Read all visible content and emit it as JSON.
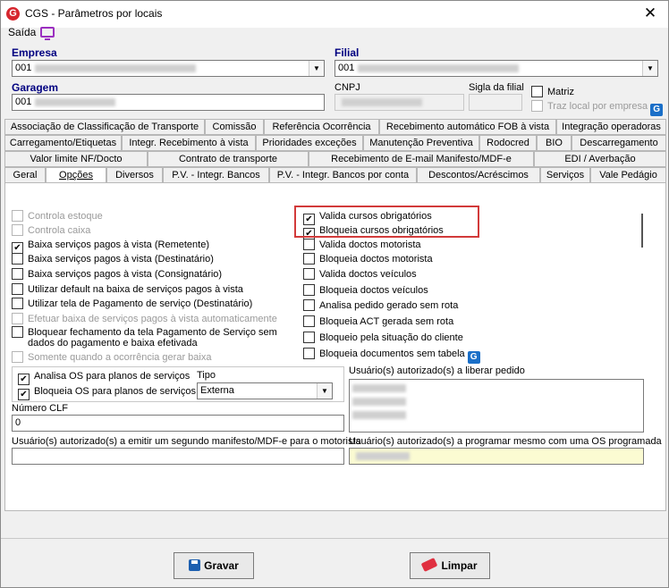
{
  "window": {
    "title": "CGS - Parâmetros por locais",
    "app_icon": "G",
    "close": "✕"
  },
  "menu": {
    "saida": "Saída"
  },
  "header": {
    "empresa_label": "Empresa",
    "empresa_value": "001",
    "filial_label": "Filial",
    "filial_value": "001",
    "garagem_label": "Garagem",
    "garagem_value": "001",
    "cnpj_label": "CNPJ",
    "sigla_label": "Sigla da filial",
    "matriz_label": "Matriz",
    "traz_local_label": "Traz local por empresa"
  },
  "tabs": {
    "row1": [
      "Associação de Classificação de Transporte",
      "Comissão",
      "Referência Ocorrência",
      "Recebimento automático FOB à vista",
      "Integração operadoras"
    ],
    "row2": [
      "Carregamento/Etiquetas",
      "Integr. Recebimento à vista",
      "Prioridades exceções",
      "Manutenção Preventiva",
      "Rodocred",
      "BIO",
      "Descarregamento"
    ],
    "row3": [
      "Valor limite NF/Docto",
      "Contrato de transporte",
      "Recebimento de E-mail Manifesto/MDF-e",
      "EDI / Averbação"
    ],
    "row4": [
      "Geral",
      "Opções",
      "Diversos",
      "P.V. - Integr. Bancos",
      "P.V. - Integr. Bancos por conta",
      "Descontos/Acréscimos",
      "Serviços",
      "Vale Pedágio"
    ]
  },
  "options_left": [
    {
      "label": "Controla estoque",
      "checked": false,
      "disabled": true
    },
    {
      "label": "Controla caixa",
      "checked": false,
      "disabled": true
    },
    {
      "label": "Baixa serviços pagos à vista (Remetente)",
      "checked": true,
      "disabled": false
    },
    {
      "label": "Baixa serviços pagos à vista (Destinatário)",
      "checked": false,
      "disabled": false
    },
    {
      "label": "Baixa serviços pagos à vista (Consignatário)",
      "checked": false,
      "disabled": false
    },
    {
      "label": "Utilizar default na baixa de serviços pagos à vista",
      "checked": false,
      "disabled": false
    },
    {
      "label": "Utilizar tela de Pagamento de serviço (Destinatário)",
      "checked": false,
      "disabled": false
    },
    {
      "label": "Efetuar baixa de serviços pagos à vista automaticamente",
      "checked": false,
      "disabled": true
    },
    {
      "label": "Bloquear fechamento da tela Pagamento de Serviço sem",
      "label2": "dados do pagamento e baixa efetivada",
      "checked": false,
      "disabled": false
    },
    {
      "label": "Somente quando a ocorrência gerar baixa",
      "checked": false,
      "disabled": true
    }
  ],
  "options_right": [
    {
      "label": "Valida cursos obrigatórios",
      "checked": true
    },
    {
      "label": "Bloqueia cursos obrigatórios",
      "checked": true
    },
    {
      "label": "Valida doctos motorista",
      "checked": false
    },
    {
      "label": "Bloqueia doctos motorista",
      "checked": false
    },
    {
      "label": "Valida doctos veículos",
      "checked": false
    },
    {
      "label": "Bloqueia doctos veículos",
      "checked": false
    },
    {
      "label": "Analisa pedido gerado sem rota",
      "checked": false
    },
    {
      "label": "Bloqueia ACT gerada sem rota",
      "checked": false
    },
    {
      "label": "Bloqueio pela situação do cliente",
      "checked": false
    },
    {
      "label": "Bloqueia documentos sem tabela",
      "checked": false
    }
  ],
  "os": {
    "analisa_label": "Analisa OS para planos de serviços",
    "analisa_checked": true,
    "bloqueia_label": "Bloqueia OS para planos de serviços",
    "bloqueia_checked": true,
    "tipo_label": "Tipo",
    "tipo_value": "Externa"
  },
  "fields": {
    "usuarios_liberar_label": "Usuário(s) autorizado(s) a liberar pedido",
    "numero_clf_label": "Número CLF",
    "numero_clf_value": "0",
    "segundo_manifesto_label": "Usuário(s) autorizado(s) a emitir um segundo manifesto/MDF-e para o motorista",
    "programar_os_label": "Usuário(s) autorizado(s) a programar mesmo com uma OS programada"
  },
  "buttons": {
    "gravar": "Gravar",
    "limpar": "Limpar"
  },
  "colors": {
    "accent": "#000080",
    "highlight": "#d23a3a",
    "brand": "#d6262e"
  }
}
